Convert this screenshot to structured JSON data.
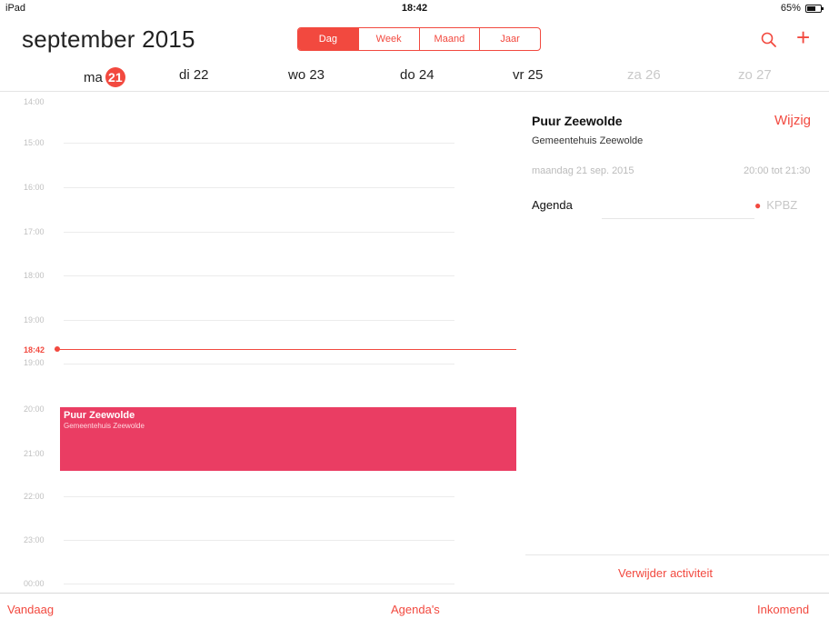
{
  "status_bar": {
    "device": "iPad",
    "time": "18:42",
    "battery": "65%"
  },
  "header": {
    "month": "september 2015",
    "segments": [
      "Dag",
      "Week",
      "Maand",
      "Jaar"
    ],
    "selected_segment": "Dag"
  },
  "days": [
    {
      "weekday": "ma",
      "date": "21",
      "today": true
    },
    {
      "label": "di 22"
    },
    {
      "label": "wo 23"
    },
    {
      "label": "do 24"
    },
    {
      "label": "vr 25"
    },
    {
      "label": "za 26"
    },
    {
      "label": "zo 27"
    }
  ],
  "hours": [
    "14:00",
    "15:00",
    "16:00",
    "17:00",
    "18:00",
    "19:00",
    "20:00",
    "21:00",
    "22:00",
    "23:00",
    "00:00"
  ],
  "current_time": "18:42",
  "event_block": {
    "title": "Puur Zeewolde",
    "location": "Gemeentehuis Zeewolde"
  },
  "detail": {
    "title": "Puur Zeewolde",
    "edit": "Wijzig",
    "location": "Gemeentehuis Zeewolde",
    "date": "maandag 21 sep. 2015",
    "time": "20:00 tot 21:30",
    "agenda_label": "Agenda",
    "agenda_value": "KPBZ",
    "delete": "Verwijder activiteit"
  },
  "toolbar": {
    "today": "Vandaag",
    "calendars": "Agenda's",
    "inbox": "Inkomend"
  },
  "colors": {
    "accent": "#f2493f",
    "event": "#ea3d63"
  }
}
